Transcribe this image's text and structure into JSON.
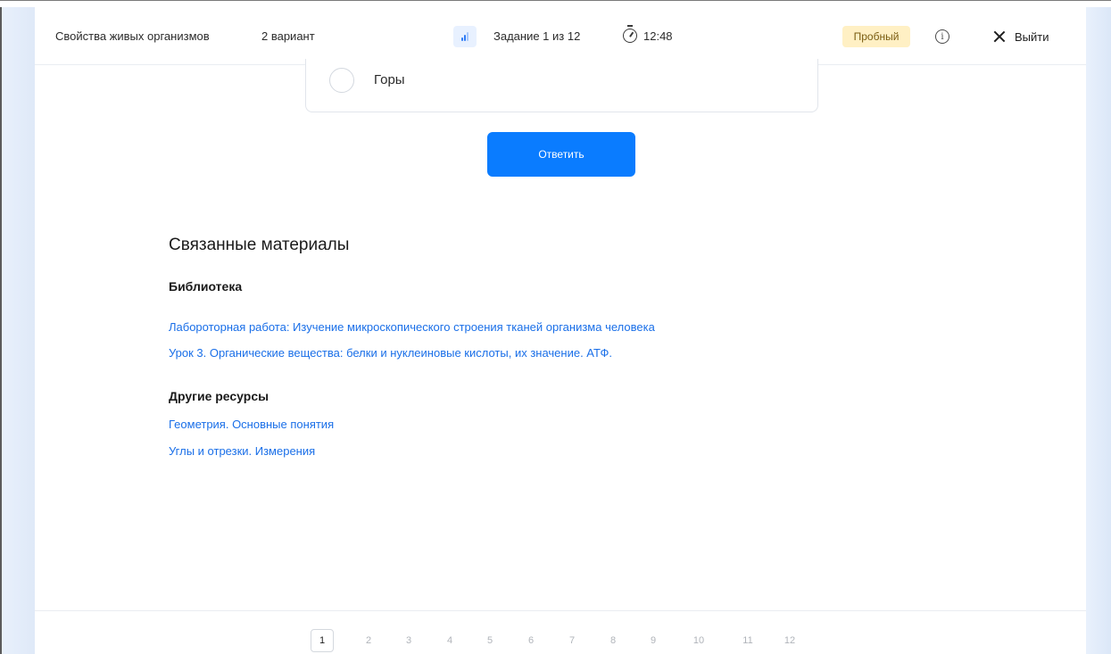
{
  "header": {
    "title": "Свойства живых организмов",
    "variant": "2 вариант",
    "task": "Задание 1 из 12",
    "timer": "12:48",
    "badge": "Пробный",
    "exit_label": "Выйти"
  },
  "question": {
    "option_label": "Горы",
    "answer_button": "Ответить"
  },
  "related": {
    "title": "Связанные материалы",
    "library_heading": "Библиотека",
    "library_links": [
      "Лабороторная работа: Изучение микроскопического строения тканей организма человека",
      "Урок 3. Органические вещества: белки и нуклеиновые кислоты, их значение. АТФ."
    ],
    "other_heading": "Другие ресурсы",
    "other_links": [
      "Геометрия. Основные понятия",
      "Углы и отрезки. Измерения"
    ]
  },
  "pagination": {
    "pages": [
      "1",
      "2",
      "3",
      "4",
      "5",
      "6",
      "7",
      "8",
      "9",
      "10",
      "11",
      "12"
    ],
    "current": "1"
  },
  "colors": {
    "accent": "#0a7cff",
    "link": "#1a6fe8",
    "badge_bg": "#fff0c4"
  }
}
